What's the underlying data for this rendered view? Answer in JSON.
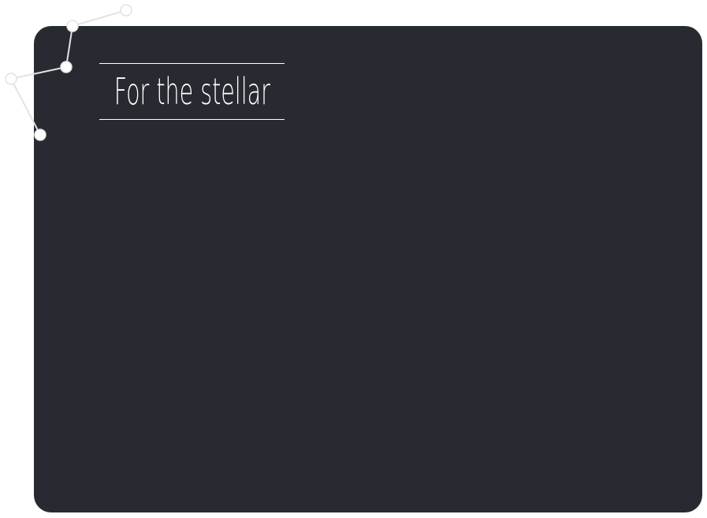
{
  "header": {
    "title": "For the stellar"
  },
  "colors": {
    "panel_background": "#272a31",
    "page_background": "#ffffff",
    "title_color": "#ffffff",
    "constellation_line": "#e3e3e3"
  },
  "decoration": {
    "constellation": "constellation-icon"
  }
}
